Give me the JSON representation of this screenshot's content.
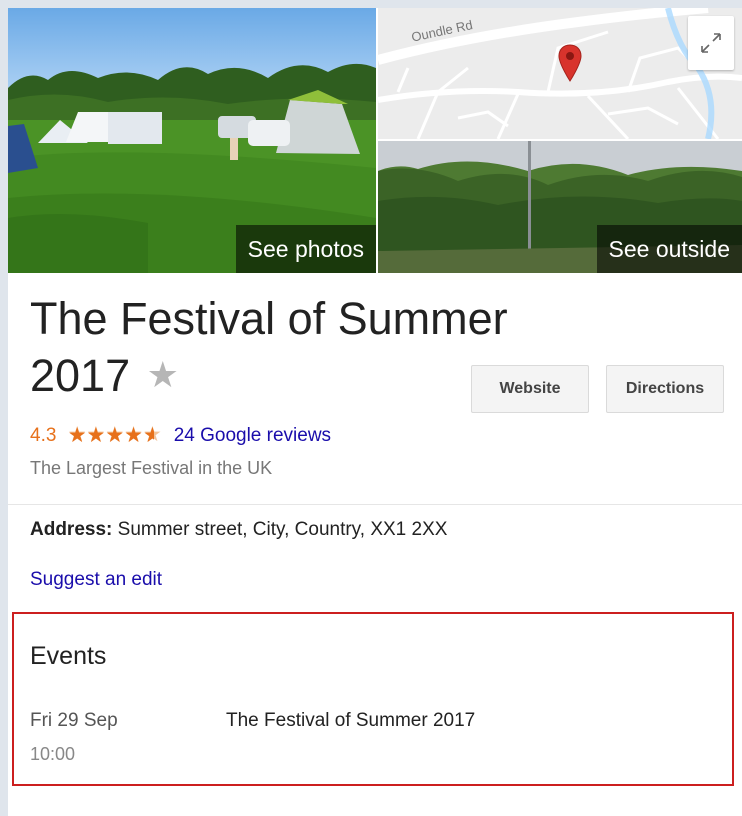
{
  "media": {
    "see_photos_label": "See photos",
    "see_outside_label": "See outside",
    "map_street_label": "Oundle Rd"
  },
  "place": {
    "title_line1": "The Festival of Summer",
    "title_line2": "2017",
    "save_star": "★",
    "rating": "4.3",
    "stars": "★★★★★",
    "rating_fraction": 0.86,
    "reviews_label": "24 Google reviews",
    "subtitle": "The Largest Festival in the UK"
  },
  "actions": {
    "website_label": "Website",
    "directions_label": "Directions"
  },
  "details": {
    "address_label": "Address:",
    "address_value": "Summer street, City, Country, XX1 2XX",
    "suggest_edit_label": "Suggest an edit"
  },
  "events": {
    "title": "Events",
    "items": [
      {
        "date": "Fri 29 Sep",
        "time": "10:00",
        "name": "The Festival of Summer 2017"
      }
    ]
  },
  "colors": {
    "rating_orange": "#e7711b",
    "link_blue": "#1a0dab",
    "highlight_red": "#cc1f1f",
    "map_pin_red": "#d8332c"
  },
  "icons": {
    "map_pin": "map-pin-icon",
    "expand": "expand-icon",
    "save_star": "star-outline-icon"
  }
}
